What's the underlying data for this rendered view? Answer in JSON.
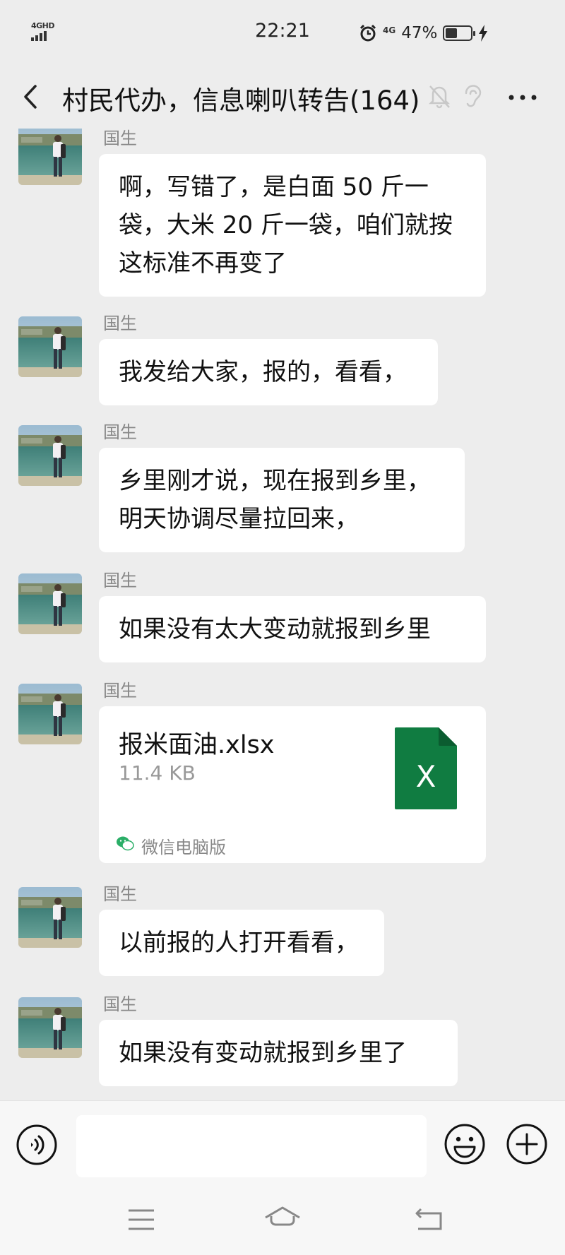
{
  "status_bar": {
    "network_left": "4GHD",
    "time": "22:21",
    "network_right": "4G",
    "battery": "47%",
    "battery_level": 0.47,
    "icons": [
      "alarm-icon",
      "battery-icon",
      "charging-bolt-icon"
    ]
  },
  "header": {
    "title": "村民代办，信息喇叭转告(164)",
    "icons": [
      "back-arrow-icon",
      "mute-bell-icon",
      "ear-icon",
      "more-dots-icon"
    ]
  },
  "messages": [
    {
      "sender": "国生",
      "type": "text",
      "text": "啊，写错了，是白面 50 斤一袋，大米 20 斤一袋，咱们就按这标准不再变了"
    },
    {
      "sender": "国生",
      "type": "text",
      "text": "我发给大家，报的，看看，"
    },
    {
      "sender": "国生",
      "type": "text",
      "text": "乡里刚才说，现在报到乡里，明天协调尽量拉回来，"
    },
    {
      "sender": "国生",
      "type": "text",
      "text": "如果没有太大变动就报到乡里"
    },
    {
      "sender": "国生",
      "type": "file",
      "file_name": "报米面油.xlsx",
      "file_size": "11.4 KB",
      "file_icon_letter": "X",
      "source": "微信电脑版"
    },
    {
      "sender": "国生",
      "type": "text",
      "text": "以前报的人打开看看，"
    },
    {
      "sender": "国生",
      "type": "text",
      "text": "如果没有变动就报到乡里了"
    }
  ],
  "input_bar": {
    "value": "",
    "icons": [
      "voice-icon",
      "emoji-icon",
      "plus-icon"
    ]
  },
  "nav_bar": {
    "icons": [
      "menu-icon",
      "home-icon",
      "back-icon"
    ]
  },
  "colors": {
    "background": "#ededed",
    "bubble": "#ffffff",
    "excel_green": "#107c41",
    "sender_gray": "#888888"
  }
}
